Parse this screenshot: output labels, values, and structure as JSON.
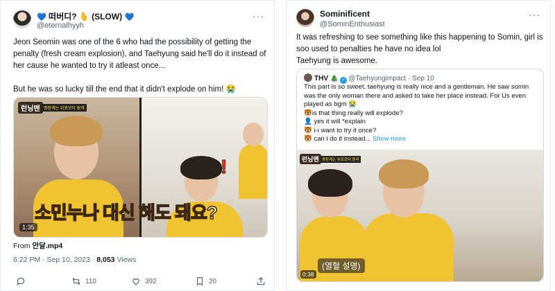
{
  "left_tweet": {
    "display_name": "떠버디? 🫰 (SLOW)",
    "handle": "@eternalhyyh",
    "text": "Jeon Seomin was one of the 6 who had the possibility of getting the penalty (fresh cream explosion), and Taehyung said he'll do it instead of her cause he wanted to try it atleast once...\n\nBut he was so lucky till the end that it didn't explode on him! 😭",
    "media": {
      "logo": "런닝맨",
      "logo_sub": "명장케는 위로모터 원격",
      "caption": "소민누나 대신 해도 돼요?",
      "duration": "1:35"
    },
    "from_label": "From",
    "from_source": "안달.mp4",
    "timestamp": "6:22 PM · Sep 10, 2023 · ",
    "views_count": "8,053",
    "views_label": " Views",
    "actions": {
      "retweets": "110",
      "likes": "392",
      "bookmarks": "20"
    }
  },
  "right_tweet": {
    "display_name": "Sominificent",
    "handle": "@SominEnthusiast",
    "text": "It was refreshing to see something like this happening to Somin, girl is soo used to penalties he have no idea lol\nTaehyung is awesome.",
    "quote": {
      "name": "THV 🎄",
      "handle": "@Taehyungimpact · Sep 10",
      "lines": [
        "This part is so sweet, taehyung is really nice and a gentleman. He saw somin",
        "was the only woman there and asked to take her place instead. For Us even",
        "played as bgm 😭",
        "🐯is that thing really will explode?",
        "👤 yes it will *explain",
        "🐯 i-i want to try it once?",
        "🐯 can i do it instead..."
      ],
      "show_more": "Show more",
      "media": {
        "logo": "런닝맨",
        "logo_sub": "명장케는 위로모터 원격",
        "caption": "(열혈 설명)",
        "duration": "0:38"
      }
    }
  },
  "icons": {
    "more": "more-dots-icon",
    "reply": "reply-icon",
    "retweet": "retweet-icon",
    "like": "heart-icon",
    "bookmark": "bookmark-icon",
    "share": "share-icon",
    "verified": "verified-badge-icon"
  },
  "colors": {
    "accent": "#1d9bf0",
    "secondary_text": "#536471",
    "border": "#e6ecf0"
  }
}
